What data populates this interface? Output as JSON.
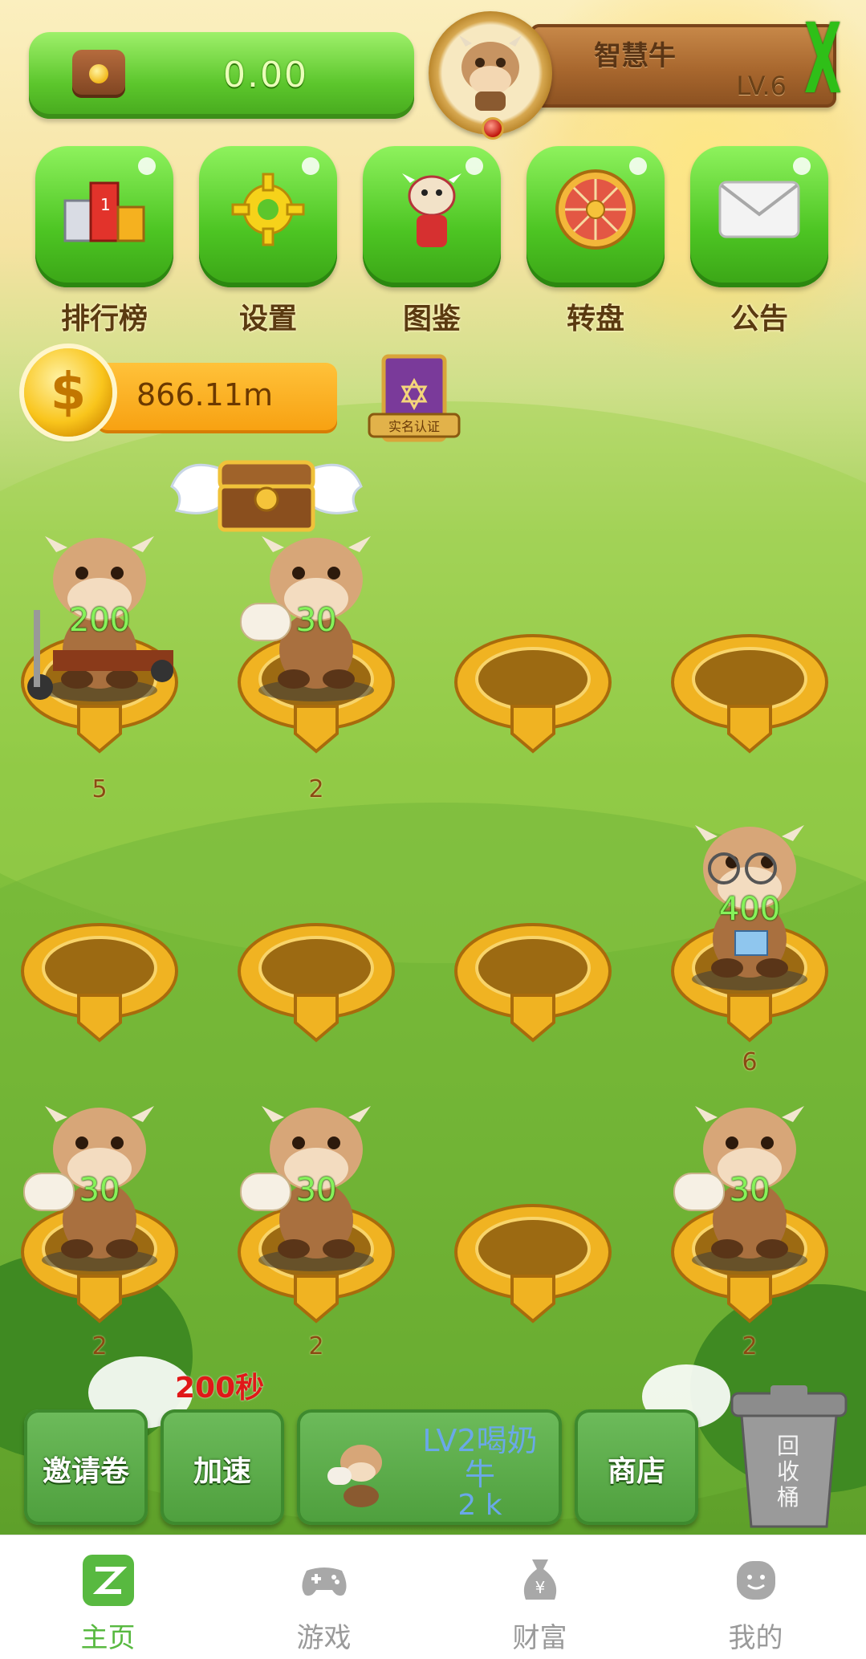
{
  "header": {
    "balance": "0.00",
    "nickname": "智慧牛",
    "level": "LV.6",
    "close_label": "X"
  },
  "menu": [
    {
      "label": "排行榜",
      "icon": "trophy-podium-icon"
    },
    {
      "label": "设置",
      "icon": "gear-icon"
    },
    {
      "label": "图鉴",
      "icon": "cow-mascot-icon"
    },
    {
      "label": "转盘",
      "icon": "wheel-icon"
    },
    {
      "label": "公告",
      "icon": "envelope-icon"
    }
  ],
  "coins": {
    "value": "866.11m",
    "symbol": "$"
  },
  "certification": {
    "label": "实名认证"
  },
  "grid": {
    "slots": [
      {
        "occupied": true,
        "cow": "scooter-cow",
        "output": "200",
        "level": "5"
      },
      {
        "occupied": true,
        "cow": "milk-cow",
        "output": "30",
        "level": "2"
      },
      {
        "occupied": false
      },
      {
        "occupied": false
      },
      {
        "occupied": false
      },
      {
        "occupied": false
      },
      {
        "occupied": false
      },
      {
        "occupied": true,
        "cow": "scholar-cow",
        "output": "400",
        "level": "6"
      },
      {
        "occupied": true,
        "cow": "milk-cow",
        "output": "30",
        "level": "2"
      },
      {
        "occupied": true,
        "cow": "milk-cow",
        "output": "30",
        "level": "2"
      },
      {
        "occupied": false
      },
      {
        "occupied": true,
        "cow": "milk-cow",
        "output": "30",
        "level": "2"
      }
    ]
  },
  "actions": {
    "invite": "邀请卷",
    "speedup": "加速",
    "speedup_timer": "200秒",
    "buy_name": "LV2喝奶牛",
    "buy_price": "2 k",
    "shop": "商店",
    "recycle": "回收桶"
  },
  "nav": [
    {
      "label": "主页",
      "icon": "home-z-icon",
      "active": true
    },
    {
      "label": "游戏",
      "icon": "gamepad-icon",
      "active": false
    },
    {
      "label": "财富",
      "icon": "money-bag-icon",
      "active": false
    },
    {
      "label": "我的",
      "icon": "profile-face-icon",
      "active": false
    }
  ],
  "colors": {
    "accent_green": "#58b940",
    "nav_inactive": "#9a9a9a",
    "timer_red": "#e01818",
    "coin_orange": "#f7a010"
  }
}
